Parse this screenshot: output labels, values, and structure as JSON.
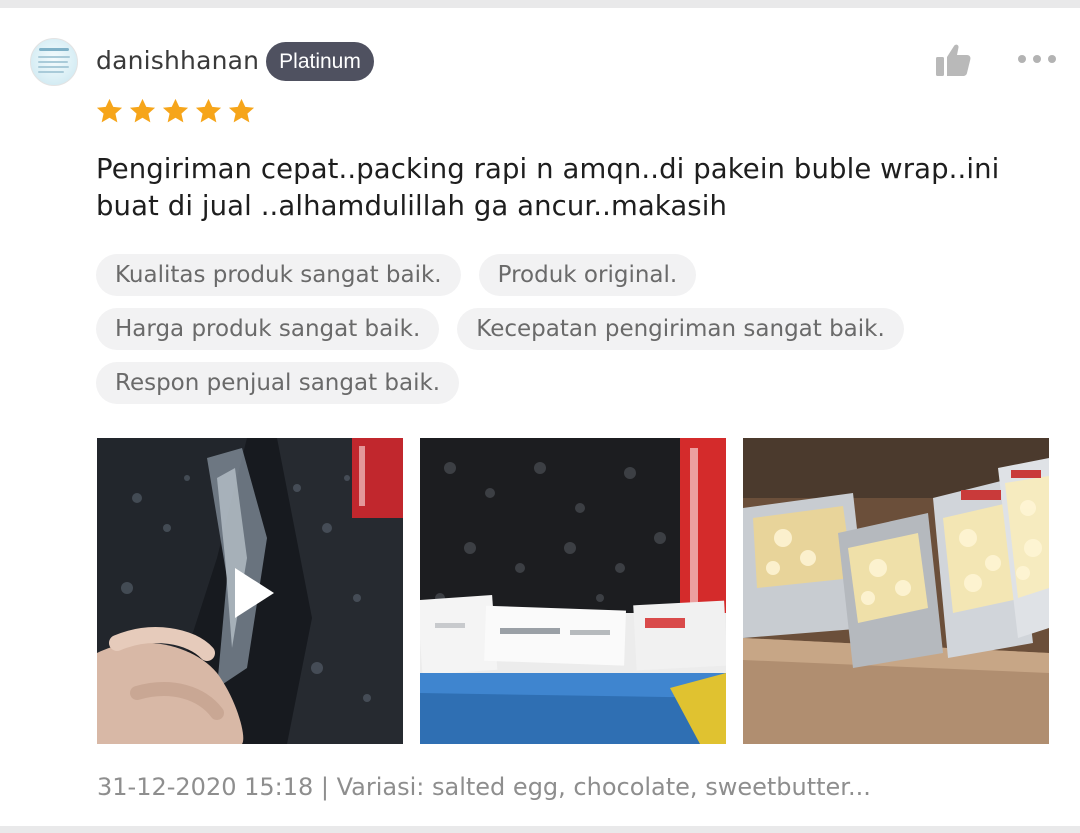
{
  "review": {
    "username": "danishhanan",
    "badge": "Platinum",
    "rating": 5,
    "star_color": "#f6a51a",
    "comment": "Pengiriman cepat..packing rapi n amqn..di pakein buble wrap..ini buat di jual ..alhamdulillah ga ancur..makasih",
    "tags": [
      [
        "Kualitas produk sangat baik.",
        "Produk original."
      ],
      [
        "Harga produk sangat baik.",
        "Kecepatan pengiriman sangat baik."
      ],
      [
        "Respon penjual sangat baik."
      ]
    ],
    "media": [
      {
        "type": "video",
        "icon": "play-icon"
      },
      {
        "type": "photo"
      },
      {
        "type": "photo"
      }
    ],
    "footer": "31-12-2020 15:18 | Variasi: salted egg, chocolate, sweetbutter..."
  },
  "icons": {
    "like": "thumbs-up-icon",
    "more": "more-options-icon"
  }
}
